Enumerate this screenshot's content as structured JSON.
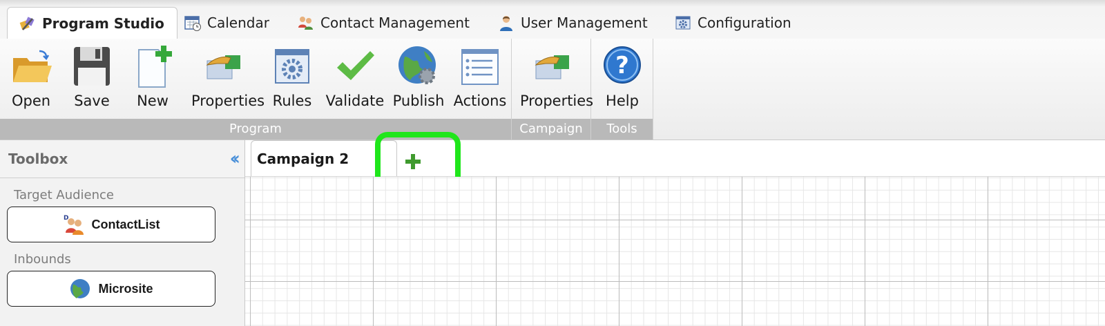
{
  "top_tabs": [
    {
      "label": "Program Studio",
      "icon": "program-studio-icon",
      "active": true
    },
    {
      "label": "Calendar",
      "icon": "calendar-icon"
    },
    {
      "label": "Contact Management",
      "icon": "contacts-icon"
    },
    {
      "label": "User Management",
      "icon": "user-icon"
    },
    {
      "label": "Configuration",
      "icon": "configuration-icon"
    }
  ],
  "ribbon": {
    "program": {
      "label": "Program",
      "buttons": [
        {
          "label": "Open",
          "icon": "folder-open-icon"
        },
        {
          "label": "Save",
          "icon": "floppy-disk-icon"
        },
        {
          "label": "New",
          "icon": "new-document-icon"
        },
        {
          "label": "Properties",
          "icon": "properties-hand-icon"
        },
        {
          "label": "Rules",
          "icon": "rules-gear-icon"
        },
        {
          "label": "Validate",
          "icon": "checkmark-icon"
        },
        {
          "label": "Publish",
          "icon": "globe-icon"
        },
        {
          "label": "Actions",
          "icon": "list-icon"
        }
      ]
    },
    "campaign": {
      "label": "Campaign",
      "buttons": [
        {
          "label": "Properties",
          "icon": "properties-hand-icon"
        }
      ]
    },
    "tools": {
      "label": "Tools",
      "buttons": [
        {
          "label": "Help",
          "icon": "help-icon"
        }
      ]
    }
  },
  "toolbox": {
    "title": "Toolbox",
    "collapse_icon": "double-chevron-left-icon",
    "sections": [
      {
        "label": "Target Audience",
        "items": [
          {
            "label": "ContactList",
            "icon": "contact-list-icon"
          }
        ]
      },
      {
        "label": "Inbounds",
        "items": [
          {
            "label": "Microsite",
            "icon": "globe-icon"
          }
        ]
      }
    ]
  },
  "canvas": {
    "tabs": [
      {
        "label": "Campaign 2"
      }
    ],
    "add_tab_icon": "plus-icon",
    "highlight_color": "#1fe61b"
  },
  "colors": {
    "accent": "#4a90d9",
    "group_bar": "#b9b9b9",
    "highlight": "#1fe61b"
  }
}
